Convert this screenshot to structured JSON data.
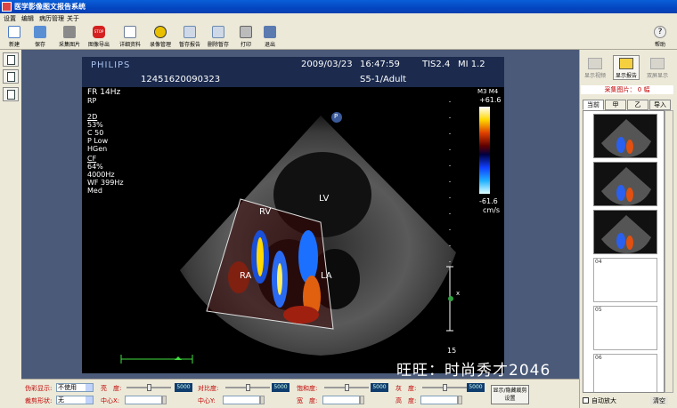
{
  "window": {
    "title": "医学影像图文报告系统"
  },
  "menu": [
    "设置",
    "编辑",
    "病历管理",
    "关于"
  ],
  "toolbar": {
    "buttons": [
      {
        "label": "新建",
        "icon": "new-document-icon",
        "color": "#4a7bc8"
      },
      {
        "label": "保存",
        "icon": "save-icon",
        "color": "#5a8fd4"
      },
      {
        "label": "采集图片",
        "icon": "capture-icon",
        "color": "#8a8a8a"
      },
      {
        "label": "图像导出",
        "icon": "stop-sign-icon",
        "color": "#d42020"
      },
      {
        "label": "详细资料",
        "icon": "document-detail-icon",
        "color": "#6a7a9a"
      },
      {
        "label": "录像管理",
        "icon": "radiation-icon",
        "color": "#e8c000"
      },
      {
        "label": "暂存报告",
        "icon": "hold-report-icon",
        "color": "#6a8ab0"
      },
      {
        "label": "删除暂存",
        "icon": "delete-hold-icon",
        "color": "#6a8ab0"
      },
      {
        "label": "打印",
        "icon": "printer-icon",
        "color": "#888888"
      },
      {
        "label": "退出",
        "icon": "exit-icon",
        "color": "#5a7ab0"
      }
    ],
    "help_label": "帮助"
  },
  "ultrasound": {
    "brand": "PHILIPS",
    "date": "2009/03/23",
    "time": "16:47:59",
    "tis": "TIS2.4",
    "mi": "MI 1.2",
    "patient_id": "12451620090323",
    "probe": "S5-1/Adult",
    "params": [
      "FR 14Hz",
      "RP",
      "2D",
      "53%",
      "C 50",
      "P Low",
      "HGen",
      "CF",
      "64%",
      "4000Hz",
      "WF 399Hz",
      "Med"
    ],
    "scale_title": "M3 M4",
    "scale_top": "+61.6",
    "scale_bottom": "-61.6",
    "scale_unit": "cm/s",
    "depth_mark": "15",
    "probe_marker": "P",
    "focus_marker": "x",
    "labels": {
      "rv": "RV",
      "lv": "LV",
      "ra": "RA",
      "la": "LA"
    }
  },
  "bottom_panel": {
    "pseudo_color_label": "伪彩显示:",
    "pseudo_color_value": "不使用",
    "crop_shape_label": "裁剪形状:",
    "crop_shape_value": "无",
    "brightness_label": "亮　度:",
    "brightness_value": "5000",
    "brightness_level": 0.5,
    "contrast_label": "对比度:",
    "contrast_value": "5000",
    "contrast_level": 0.5,
    "saturation_label": "饱和度:",
    "saturation_value": "5000",
    "saturation_level": 0.5,
    "gray_label": "灰　度:",
    "gray_value": "5000",
    "gray_level": 0.5,
    "center_x_label": "中心X:",
    "center_y_label": "中心Y:",
    "width_label": "宽　度:",
    "height_label": "高　度:",
    "toggle_button": "显示/隐藏裁剪设置"
  },
  "right_panel": {
    "buttons": [
      "显示视频",
      "显示报告",
      "双屏显示"
    ],
    "count_text": "采集图片： 0 幅",
    "tabs": [
      "当前",
      "甲",
      "乙",
      "导入"
    ],
    "empty_slots": [
      "04",
      "05",
      "06"
    ],
    "auto_zoom": "自动放大",
    "clear": "清空"
  },
  "overlay": {
    "watermark": "旺旺：时尚秀才2046"
  }
}
